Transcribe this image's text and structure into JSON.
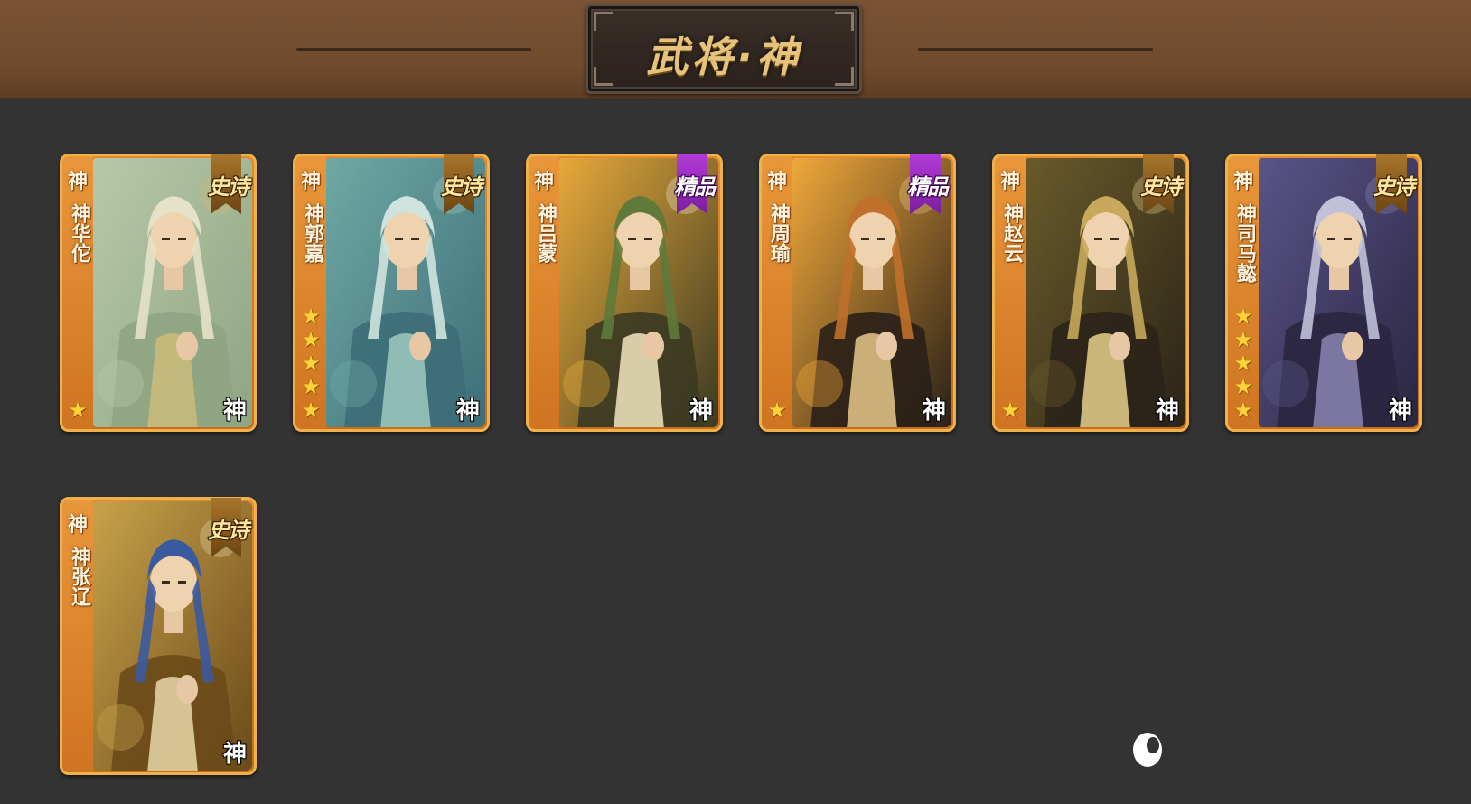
{
  "header": {
    "title": "武将·神"
  },
  "cards": [
    {
      "faction": "神",
      "name": "神华佗",
      "rarity": "史诗",
      "rarity_type": "epic",
      "stars": 1,
      "corner_label": "神",
      "palette": [
        "#b7c8a8",
        "#e6e2c8",
        "#8fa582",
        "#cdbb7a"
      ],
      "portrait": "white-bearded sage"
    },
    {
      "faction": "神",
      "name": "神郭嘉",
      "rarity": "史诗",
      "rarity_type": "epic",
      "stars": 5,
      "corner_label": "神",
      "palette": [
        "#6fa8a4",
        "#cfe3de",
        "#3d6e78",
        "#9ec9c0"
      ],
      "portrait": "silver-haired strategist"
    },
    {
      "faction": "神",
      "name": "神吕蒙",
      "rarity": "精品",
      "rarity_type": "fine",
      "stars": 0,
      "corner_label": "神",
      "palette": [
        "#e7a93a",
        "#5f7a3a",
        "#3b3a22",
        "#f2e6c0"
      ],
      "portrait": "white-haired general"
    },
    {
      "faction": "神",
      "name": "神周瑜",
      "rarity": "精品",
      "rarity_type": "fine",
      "stars": 1,
      "corner_label": "神",
      "palette": [
        "#f0a83a",
        "#c0702a",
        "#2a2018",
        "#e6c88a"
      ],
      "portrait": "musician with zither"
    },
    {
      "faction": "神",
      "name": "神赵云",
      "rarity": "史诗",
      "rarity_type": "epic",
      "stars": 1,
      "corner_label": "神",
      "palette": [
        "#6a5a2a",
        "#c8a85a",
        "#2a2418",
        "#e6d08a"
      ],
      "portrait": "golden-haired spearman"
    },
    {
      "faction": "神",
      "name": "神司马懿",
      "rarity": "史诗",
      "rarity_type": "epic",
      "stars": 5,
      "corner_label": "神",
      "palette": [
        "#5a5488",
        "#c0c0d8",
        "#2a2640",
        "#8a86b0"
      ],
      "portrait": "armored tactician"
    },
    {
      "faction": "神",
      "name": "神张辽",
      "rarity": "史诗",
      "rarity_type": "epic",
      "stars": 0,
      "corner_label": "神",
      "palette": [
        "#c8a24a",
        "#3a5aa0",
        "#6a4a1a",
        "#e8d8a8"
      ],
      "portrait": "golden-armored warrior"
    }
  ],
  "icons": {
    "star": "star-icon",
    "rarity": "ribbon-badge-icon"
  },
  "colors": {
    "background": "#333333",
    "header": "#6f4a2d",
    "card_frame": "#f0b04a",
    "card_strip": "#e28a2e",
    "epic_ribbon": "#a8752a",
    "fine_ribbon": "#b33ad8",
    "star": "#ffd23a"
  }
}
